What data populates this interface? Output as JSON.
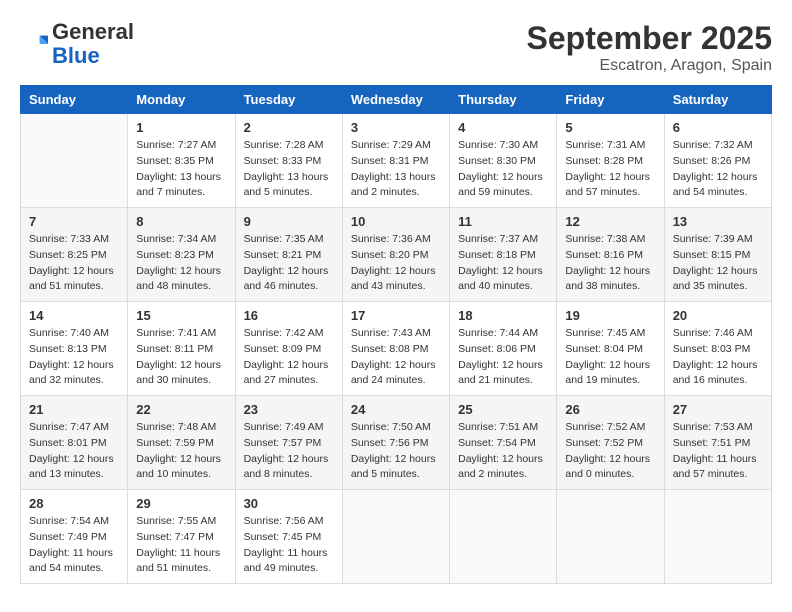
{
  "header": {
    "logo_general": "General",
    "logo_blue": "Blue",
    "month_title": "September 2025",
    "location": "Escatron, Aragon, Spain"
  },
  "days_of_week": [
    "Sunday",
    "Monday",
    "Tuesday",
    "Wednesday",
    "Thursday",
    "Friday",
    "Saturday"
  ],
  "weeks": [
    [
      {
        "day": "",
        "info": ""
      },
      {
        "day": "1",
        "info": "Sunrise: 7:27 AM\nSunset: 8:35 PM\nDaylight: 13 hours\nand 7 minutes."
      },
      {
        "day": "2",
        "info": "Sunrise: 7:28 AM\nSunset: 8:33 PM\nDaylight: 13 hours\nand 5 minutes."
      },
      {
        "day": "3",
        "info": "Sunrise: 7:29 AM\nSunset: 8:31 PM\nDaylight: 13 hours\nand 2 minutes."
      },
      {
        "day": "4",
        "info": "Sunrise: 7:30 AM\nSunset: 8:30 PM\nDaylight: 12 hours\nand 59 minutes."
      },
      {
        "day": "5",
        "info": "Sunrise: 7:31 AM\nSunset: 8:28 PM\nDaylight: 12 hours\nand 57 minutes."
      },
      {
        "day": "6",
        "info": "Sunrise: 7:32 AM\nSunset: 8:26 PM\nDaylight: 12 hours\nand 54 minutes."
      }
    ],
    [
      {
        "day": "7",
        "info": "Sunrise: 7:33 AM\nSunset: 8:25 PM\nDaylight: 12 hours\nand 51 minutes."
      },
      {
        "day": "8",
        "info": "Sunrise: 7:34 AM\nSunset: 8:23 PM\nDaylight: 12 hours\nand 48 minutes."
      },
      {
        "day": "9",
        "info": "Sunrise: 7:35 AM\nSunset: 8:21 PM\nDaylight: 12 hours\nand 46 minutes."
      },
      {
        "day": "10",
        "info": "Sunrise: 7:36 AM\nSunset: 8:20 PM\nDaylight: 12 hours\nand 43 minutes."
      },
      {
        "day": "11",
        "info": "Sunrise: 7:37 AM\nSunset: 8:18 PM\nDaylight: 12 hours\nand 40 minutes."
      },
      {
        "day": "12",
        "info": "Sunrise: 7:38 AM\nSunset: 8:16 PM\nDaylight: 12 hours\nand 38 minutes."
      },
      {
        "day": "13",
        "info": "Sunrise: 7:39 AM\nSunset: 8:15 PM\nDaylight: 12 hours\nand 35 minutes."
      }
    ],
    [
      {
        "day": "14",
        "info": "Sunrise: 7:40 AM\nSunset: 8:13 PM\nDaylight: 12 hours\nand 32 minutes."
      },
      {
        "day": "15",
        "info": "Sunrise: 7:41 AM\nSunset: 8:11 PM\nDaylight: 12 hours\nand 30 minutes."
      },
      {
        "day": "16",
        "info": "Sunrise: 7:42 AM\nSunset: 8:09 PM\nDaylight: 12 hours\nand 27 minutes."
      },
      {
        "day": "17",
        "info": "Sunrise: 7:43 AM\nSunset: 8:08 PM\nDaylight: 12 hours\nand 24 minutes."
      },
      {
        "day": "18",
        "info": "Sunrise: 7:44 AM\nSunset: 8:06 PM\nDaylight: 12 hours\nand 21 minutes."
      },
      {
        "day": "19",
        "info": "Sunrise: 7:45 AM\nSunset: 8:04 PM\nDaylight: 12 hours\nand 19 minutes."
      },
      {
        "day": "20",
        "info": "Sunrise: 7:46 AM\nSunset: 8:03 PM\nDaylight: 12 hours\nand 16 minutes."
      }
    ],
    [
      {
        "day": "21",
        "info": "Sunrise: 7:47 AM\nSunset: 8:01 PM\nDaylight: 12 hours\nand 13 minutes."
      },
      {
        "day": "22",
        "info": "Sunrise: 7:48 AM\nSunset: 7:59 PM\nDaylight: 12 hours\nand 10 minutes."
      },
      {
        "day": "23",
        "info": "Sunrise: 7:49 AM\nSunset: 7:57 PM\nDaylight: 12 hours\nand 8 minutes."
      },
      {
        "day": "24",
        "info": "Sunrise: 7:50 AM\nSunset: 7:56 PM\nDaylight: 12 hours\nand 5 minutes."
      },
      {
        "day": "25",
        "info": "Sunrise: 7:51 AM\nSunset: 7:54 PM\nDaylight: 12 hours\nand 2 minutes."
      },
      {
        "day": "26",
        "info": "Sunrise: 7:52 AM\nSunset: 7:52 PM\nDaylight: 12 hours\nand 0 minutes."
      },
      {
        "day": "27",
        "info": "Sunrise: 7:53 AM\nSunset: 7:51 PM\nDaylight: 11 hours\nand 57 minutes."
      }
    ],
    [
      {
        "day": "28",
        "info": "Sunrise: 7:54 AM\nSunset: 7:49 PM\nDaylight: 11 hours\nand 54 minutes."
      },
      {
        "day": "29",
        "info": "Sunrise: 7:55 AM\nSunset: 7:47 PM\nDaylight: 11 hours\nand 51 minutes."
      },
      {
        "day": "30",
        "info": "Sunrise: 7:56 AM\nSunset: 7:45 PM\nDaylight: 11 hours\nand 49 minutes."
      },
      {
        "day": "",
        "info": ""
      },
      {
        "day": "",
        "info": ""
      },
      {
        "day": "",
        "info": ""
      },
      {
        "day": "",
        "info": ""
      }
    ]
  ]
}
